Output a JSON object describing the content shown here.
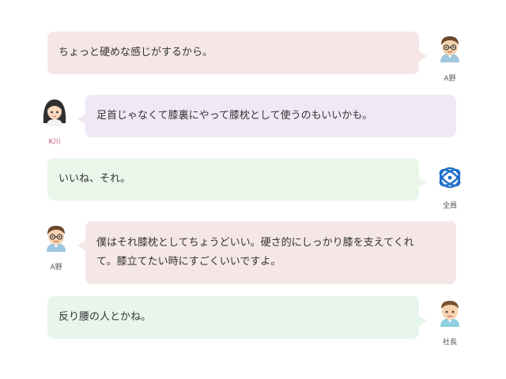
{
  "colors": {
    "pink": "#f6e7e7",
    "purple": "#f1e8f6",
    "green": "#eaf6ea",
    "mint": "#e7f5ec"
  },
  "messages": [
    {
      "speaker": "A野",
      "side": "right",
      "color": "pink",
      "avatar_icon": "man-with-glasses-icon",
      "lines": [
        "ちょっと硬めな感じがするから。"
      ]
    },
    {
      "speaker": "K川",
      "side": "left",
      "color": "purple",
      "avatar_icon": "woman-avatar-icon",
      "lines": [
        "足首じゃなくて膝裏にやって膝枕として使うのもいいかも。"
      ]
    },
    {
      "speaker": "全員",
      "side": "right",
      "color": "green",
      "avatar_icon": "globe-logo-icon",
      "lines": [
        "いいね、それ。"
      ]
    },
    {
      "speaker": "A野",
      "side": "left",
      "color": "pink",
      "avatar_icon": "man-with-glasses-icon",
      "lines": [
        "僕はそれ膝枕としてちょうどいい。硬さ的にしっかり膝を支えてくれ",
        "て。膝立てたい時にすごくいいですよ。"
      ]
    },
    {
      "speaker": "社長",
      "side": "right",
      "color": "mint",
      "avatar_icon": "man-avatar-icon",
      "lines": [
        "反り腰の人とかね。"
      ]
    }
  ]
}
